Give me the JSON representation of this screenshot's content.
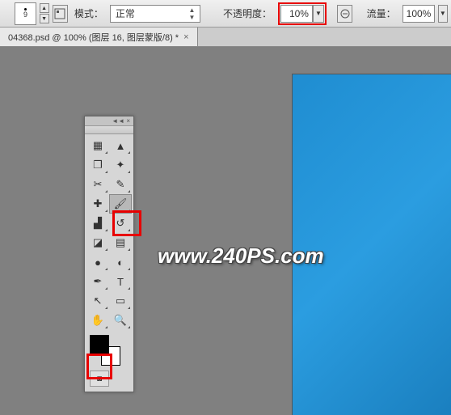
{
  "toolbar": {
    "brush_size": "9",
    "mode_label": "模式：",
    "mode_value": "正常",
    "opacity_label": "不透明度：",
    "opacity_value": "10%",
    "flow_label": "流量：",
    "flow_value": "100%"
  },
  "tab": {
    "title": "04368.psd @ 100% (图层 16, 图层蒙版/8) *",
    "close": "×"
  },
  "tools": {
    "panel_collapse": "◄◄ ×",
    "items": [
      {
        "name": "move-tool",
        "glyph": "▦"
      },
      {
        "name": "marquee-tool",
        "glyph": "▲"
      },
      {
        "name": "lasso-tool",
        "glyph": "❐"
      },
      {
        "name": "wand-tool",
        "glyph": "✦"
      },
      {
        "name": "crop-tool",
        "glyph": "✂"
      },
      {
        "name": "eyedropper-tool",
        "glyph": "✎"
      },
      {
        "name": "patch-tool",
        "glyph": "✚"
      },
      {
        "name": "brush-tool",
        "glyph": "🖌"
      },
      {
        "name": "stamp-tool",
        "glyph": "▟"
      },
      {
        "name": "history-brush-tool",
        "glyph": "↺"
      },
      {
        "name": "eraser-tool",
        "glyph": "◪"
      },
      {
        "name": "gradient-tool",
        "glyph": "▤"
      },
      {
        "name": "blur-tool",
        "glyph": "●"
      },
      {
        "name": "dodge-tool",
        "glyph": "◐"
      },
      {
        "name": "pen-tool",
        "glyph": "✒"
      },
      {
        "name": "type-tool",
        "glyph": "T"
      },
      {
        "name": "path-tool",
        "glyph": "↖"
      },
      {
        "name": "shape-tool",
        "glyph": "▭"
      },
      {
        "name": "hand-tool",
        "glyph": "✋"
      },
      {
        "name": "zoom-tool",
        "glyph": "🔍"
      }
    ]
  },
  "colors": {
    "foreground": "#000000",
    "background": "#ffffff"
  },
  "watermark": "www.240PS.com"
}
